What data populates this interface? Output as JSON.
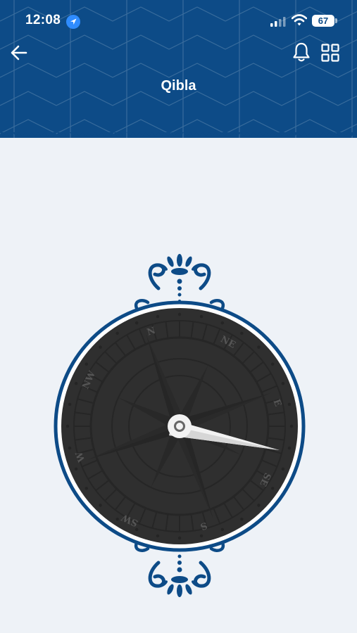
{
  "status_bar": {
    "time": "12:08",
    "battery": "67",
    "icons": [
      "location-arrow-icon",
      "signal-icon",
      "wifi-icon",
      "battery-icon"
    ]
  },
  "header": {
    "title": "Qibla",
    "icons": [
      "back-arrow-icon",
      "bell-icon",
      "grid-icon"
    ],
    "color": "#0d4b87"
  },
  "compass": {
    "directions": {
      "n": "N",
      "ne": "NE",
      "e": "E",
      "se": "SE",
      "s": "S",
      "sw": "SW",
      "w": "W",
      "nw": "NW"
    },
    "frame_color": "#0d4b87",
    "dial_color": "#2f2f2f"
  }
}
